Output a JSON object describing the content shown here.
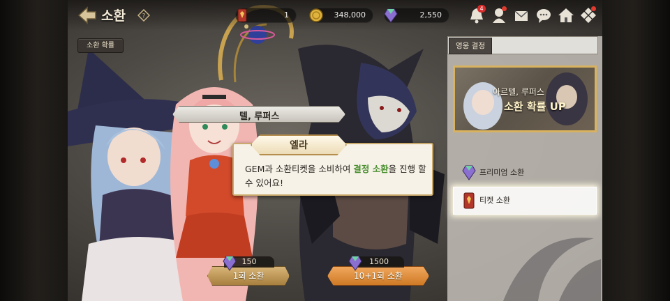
{
  "header": {
    "title": "소환",
    "help_icon": "help-diamond-icon"
  },
  "resources": [
    {
      "name": "summon-ticket",
      "value": "1",
      "icon": "ticket-icon"
    },
    {
      "name": "gold",
      "value": "348,000",
      "icon": "gold-coin-icon"
    },
    {
      "name": "gem",
      "value": "2,550",
      "icon": "gem-icon"
    }
  ],
  "top_icons": [
    {
      "name": "notification-bell-icon",
      "badge": "4"
    },
    {
      "name": "hero-icon",
      "badge": ""
    },
    {
      "name": "mail-icon",
      "badge": ""
    },
    {
      "name": "chat-icon",
      "badge": ""
    },
    {
      "name": "home-icon",
      "badge": ""
    },
    {
      "name": "menu-grid-icon",
      "badge": ""
    }
  ],
  "rate_button": "소환 확률",
  "hero_bar": "텔, 루퍼스",
  "dialog": {
    "speaker": "엘라",
    "text_before": "GEM과 소환티켓을 소비하여 ",
    "highlight": "결정 소환",
    "text_after": "을 진행 할 수 있어요!"
  },
  "summon_buttons": [
    {
      "cost": "150",
      "label": "1회 소환"
    },
    {
      "cost": "1500",
      "label": "10+1회 소환"
    }
  ],
  "panel": {
    "tab_label": "영웅 결정",
    "banner_line1": "아르텔, 루퍼스",
    "banner_line2": "소환 확률 UP",
    "menu": [
      {
        "label": "프리미엄 소환",
        "icon": "gem-icon",
        "selected": false
      },
      {
        "label": "티켓 소환",
        "icon": "ticket-icon",
        "selected": true
      }
    ]
  },
  "colors": {
    "accent_gold": "#c9aa6c",
    "highlight_green": "#4a8f2f",
    "button_orange": "#cf7a25",
    "badge_red": "#d62c2c"
  }
}
